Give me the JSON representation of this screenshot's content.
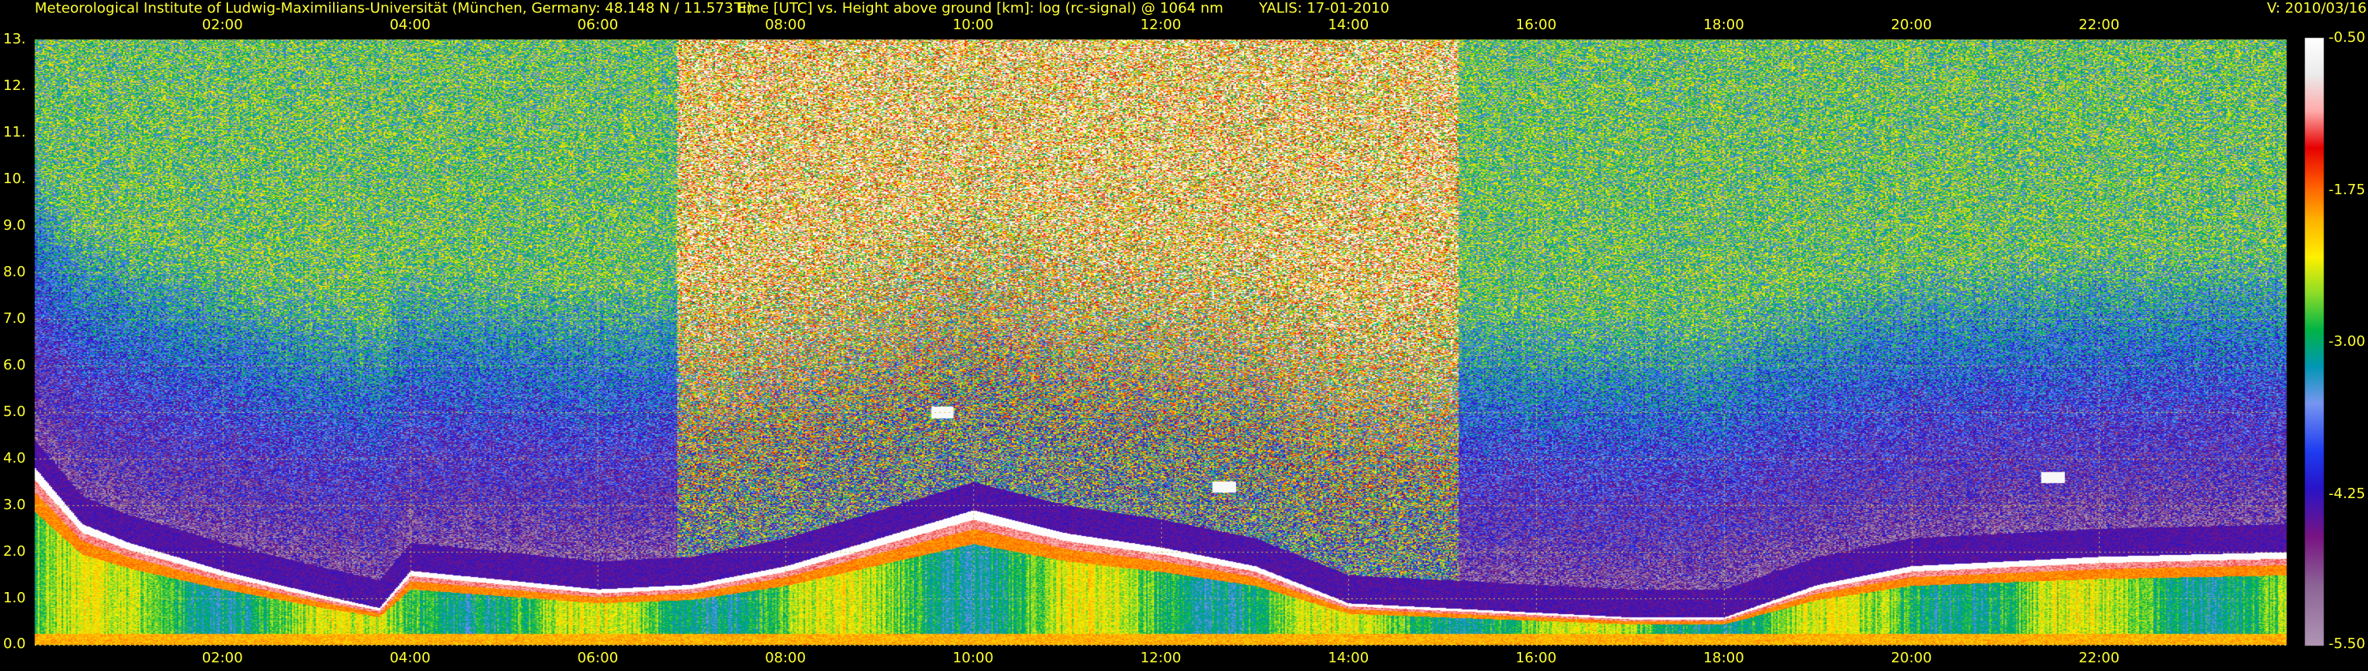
{
  "header": {
    "institute": "Meteorological Institute of Ludwig-Maximilians-Universität (München, Germany: 48.148 N / 11.573 E):",
    "plot_title": "Time [UTC] vs. Height above ground [km]: log (rc-signal) @ 1064 nm",
    "instrument_date": "YALIS: 17-01-2010",
    "version": "V: 2010/03/16"
  },
  "colors": {
    "background": "#000000",
    "header_text": "#ffff33",
    "axis_text": "#ffff33",
    "grid": "#c8c850"
  },
  "chart_data": {
    "type": "heatmap",
    "title": "Time [UTC] vs. Height above ground [km]: log (rc-signal) @ 1064 nm",
    "x": {
      "quantity": "Time [UTC]",
      "range": [
        "00:00",
        "24:00"
      ],
      "tick_labels": [
        "02:00",
        "04:00",
        "06:00",
        "08:00",
        "10:00",
        "12:00",
        "14:00",
        "16:00",
        "18:00",
        "20:00",
        "22:00"
      ],
      "tick_hours": [
        2,
        4,
        6,
        8,
        10,
        12,
        14,
        16,
        18,
        20,
        22
      ],
      "top_and_bottom": true
    },
    "y": {
      "quantity": "Height above ground [km]",
      "range": [
        0,
        13
      ],
      "tick_labels": [
        "0.0",
        "1.0",
        "2.0",
        "3.0",
        "4.0",
        "5.0",
        "6.0",
        "7.0",
        "8.0",
        "9.0",
        "10.",
        "11.",
        "12.",
        "13."
      ],
      "tick_values": [
        0,
        1,
        2,
        3,
        4,
        5,
        6,
        7,
        8,
        9,
        10,
        11,
        12,
        13
      ]
    },
    "colorbar": {
      "quantity": "log (rc-signal)",
      "range": [
        -5.5,
        -0.5
      ],
      "tick_labels": [
        "-0.50",
        "-1.75",
        "-3.00",
        "-4.25",
        "-5.50"
      ],
      "tick_values": [
        -0.5,
        -1.75,
        -3.0,
        -4.25,
        -5.5
      ],
      "placement": "right"
    },
    "grid": true,
    "grid_style": "dotted",
    "features": {
      "boundary_layer_top_km": [
        {
          "time": "00:00",
          "value": 3.8
        },
        {
          "time": "00:30",
          "value": 2.6
        },
        {
          "time": "01:00",
          "value": 2.2
        },
        {
          "time": "02:00",
          "value": 1.6
        },
        {
          "time": "03:00",
          "value": 1.1
        },
        {
          "time": "03:40",
          "value": 0.8
        },
        {
          "time": "04:00",
          "value": 1.6
        },
        {
          "time": "05:00",
          "value": 1.4
        },
        {
          "time": "06:00",
          "value": 1.2
        },
        {
          "time": "07:00",
          "value": 1.3
        },
        {
          "time": "08:00",
          "value": 1.7
        },
        {
          "time": "09:00",
          "value": 2.3
        },
        {
          "time": "10:00",
          "value": 2.9
        },
        {
          "time": "11:00",
          "value": 2.4
        },
        {
          "time": "12:00",
          "value": 2.1
        },
        {
          "time": "13:00",
          "value": 1.7
        },
        {
          "time": "14:00",
          "value": 0.9
        },
        {
          "time": "15:00",
          "value": 0.8
        },
        {
          "time": "16:00",
          "value": 0.7
        },
        {
          "time": "17:00",
          "value": 0.6
        },
        {
          "time": "18:00",
          "value": 0.6
        },
        {
          "time": "19:00",
          "value": 1.3
        },
        {
          "time": "20:00",
          "value": 1.7
        },
        {
          "time": "21:00",
          "value": 1.8
        },
        {
          "time": "22:00",
          "value": 1.9
        },
        {
          "time": "23:59",
          "value": 2.0
        }
      ],
      "elevated_layers_km": [
        {
          "time": "09:40",
          "value": 5.0
        },
        {
          "time": "12:40",
          "value": 3.4
        },
        {
          "time": "21:30",
          "value": 3.6
        }
      ],
      "high_noise_period": [
        "06:50",
        "15:10"
      ]
    }
  }
}
